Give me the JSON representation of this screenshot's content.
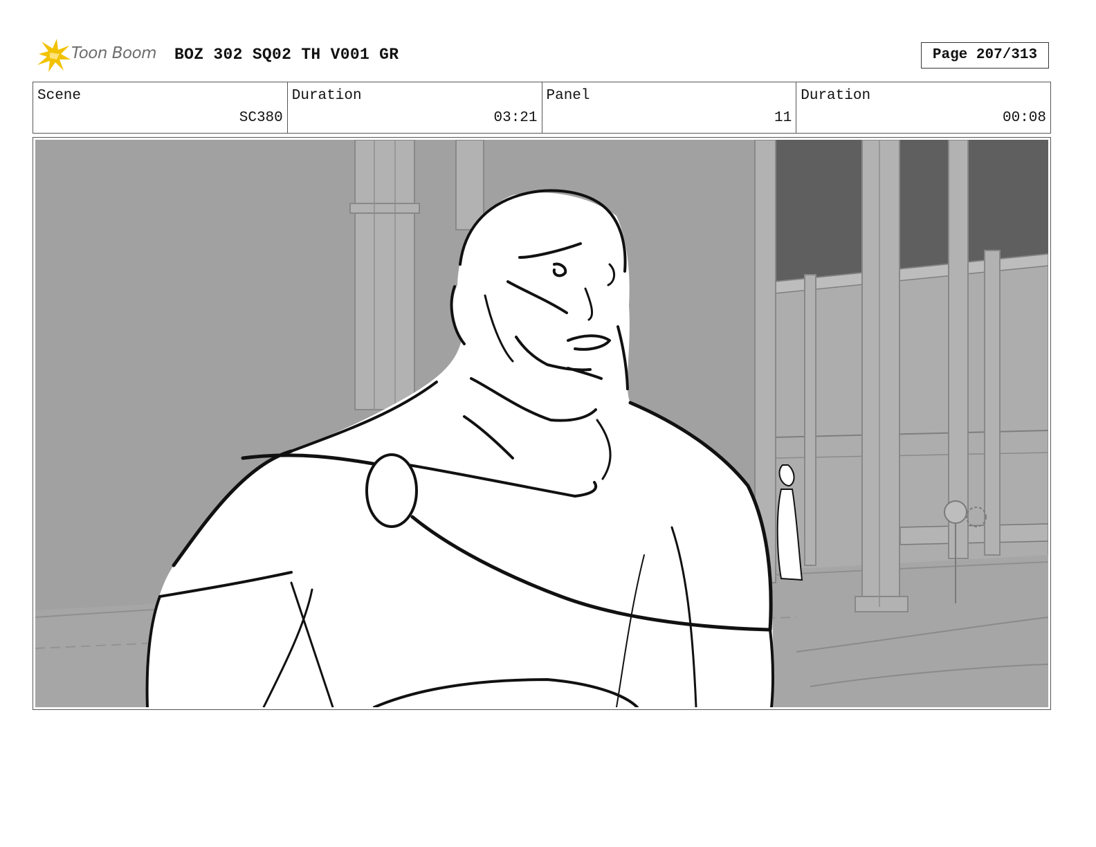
{
  "header": {
    "logo_text": "Toon Boom",
    "title": "BOZ 302 SQ02 TH V001 GR",
    "page_label": "Page 207/313"
  },
  "info": {
    "scene_label": "Scene",
    "scene_value": "SC380",
    "duration_label": "Duration",
    "duration_value": "03:21",
    "panel_label": "Panel",
    "panel_value": "11",
    "panel_duration_label": "Duration",
    "panel_duration_value": "00:08"
  },
  "colors": {
    "logo_star": "#f2c200",
    "background_gray": "#9f9f9f",
    "sky_dark": "#5e5e5e",
    "ink": "#111111"
  },
  "icons": {
    "logo": "toon-boom-star-icon"
  }
}
